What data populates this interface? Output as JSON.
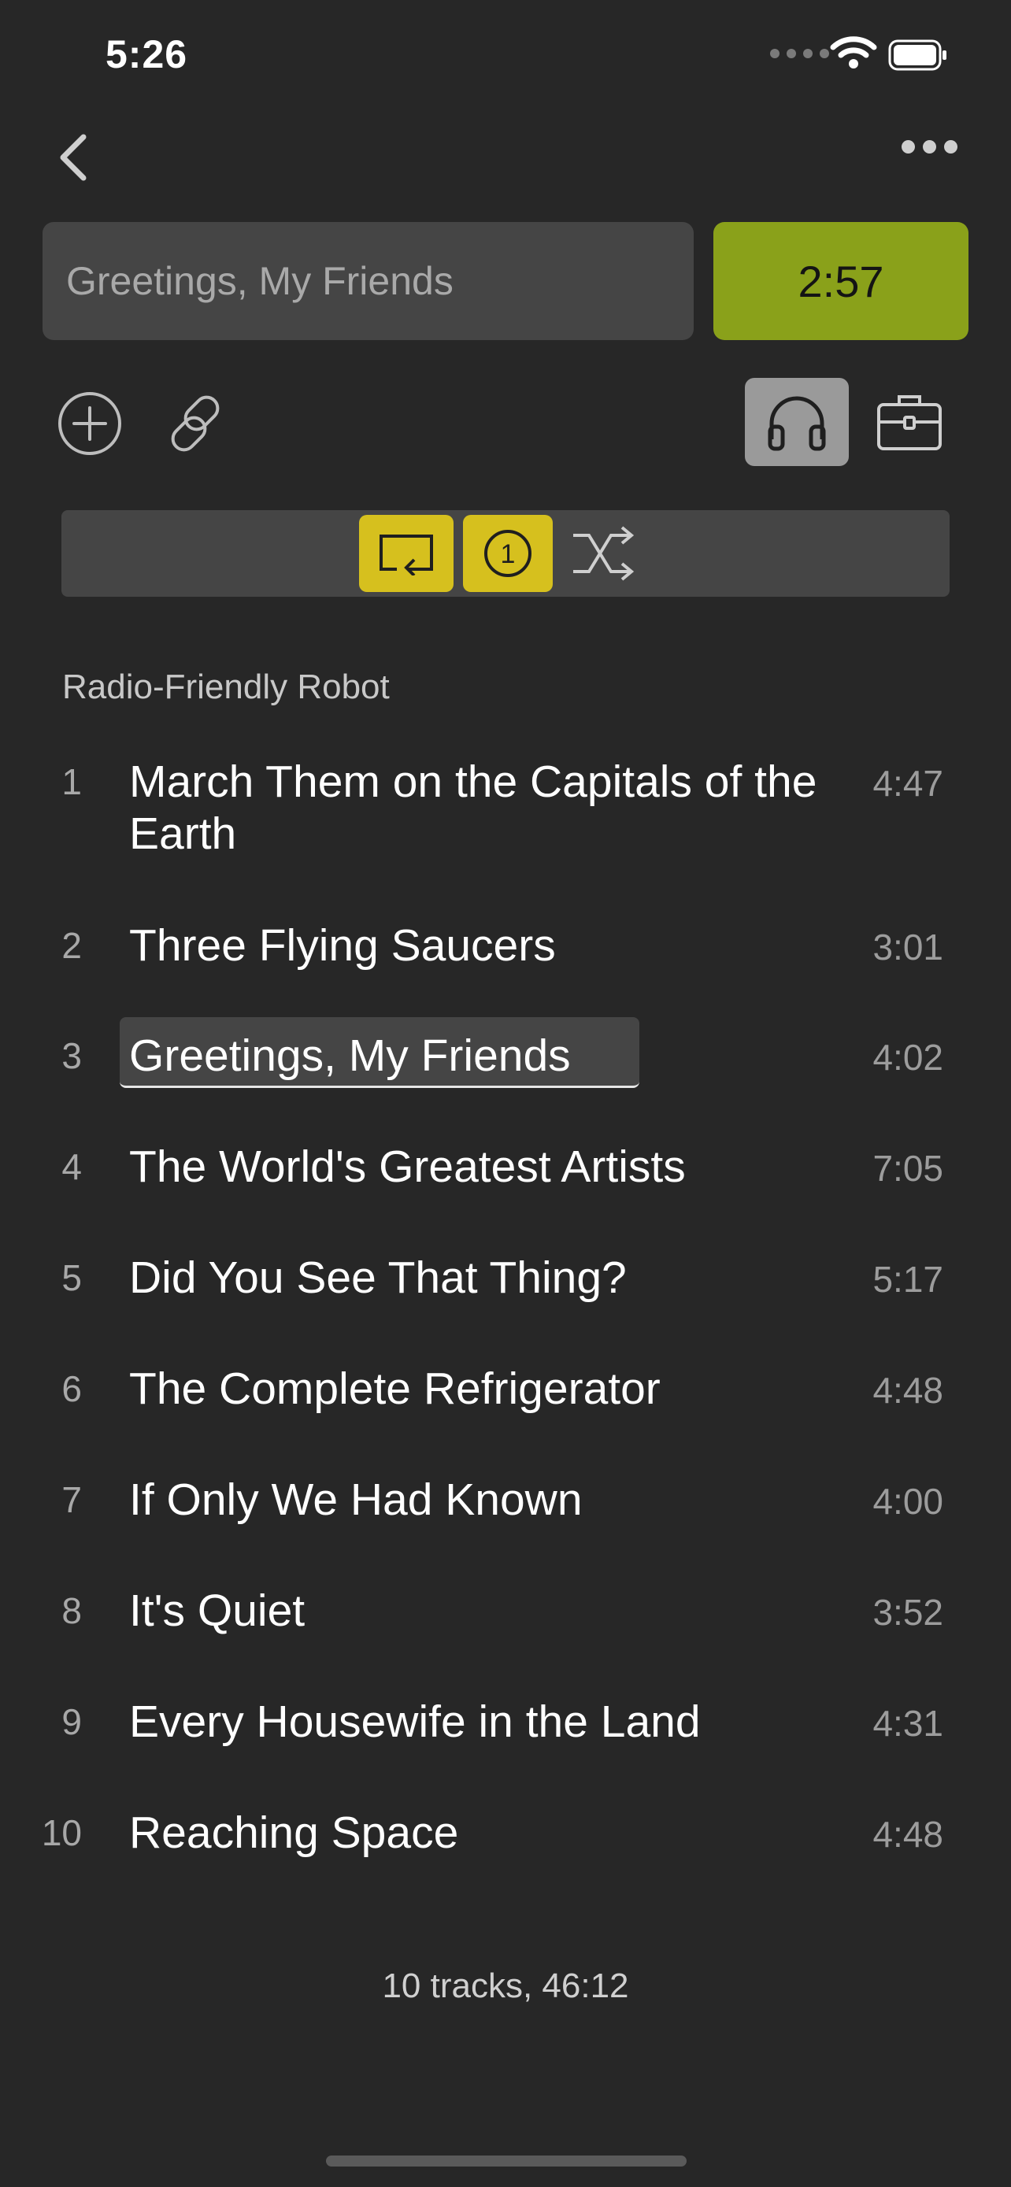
{
  "status_bar": {
    "time": "5:26"
  },
  "header": {
    "back_icon": "chevron-left-icon",
    "more_icon": "ellipsis-icon"
  },
  "now_playing": {
    "title_value": "Greetings, My Friends",
    "timer": "2:57",
    "timer_color": "#8aa11a"
  },
  "toolbar": {
    "icons": [
      "plus-circle-icon",
      "link-icon",
      "headphones-icon",
      "toolbox-icon"
    ],
    "selected": "headphones-icon"
  },
  "playback_modes": {
    "accent_color": "#d6c01e",
    "items": [
      {
        "icon": "repeat-icon",
        "active": true
      },
      {
        "icon": "repeat-one-icon",
        "label": "1",
        "active": true
      },
      {
        "icon": "shuffle-icon",
        "active": false
      }
    ]
  },
  "album": {
    "title": "Radio-Friendly Robot"
  },
  "tracks": [
    {
      "num": "1",
      "title": "March Them on the Capitals of the Earth",
      "duration": "4:47"
    },
    {
      "num": "2",
      "title": "Three Flying Saucers",
      "duration": "3:01"
    },
    {
      "num": "3",
      "title": "Greetings, My Friends",
      "duration": "4:02",
      "current": true
    },
    {
      "num": "4",
      "title": "The World's Greatest Artists",
      "duration": "7:05"
    },
    {
      "num": "5",
      "title": "Did You See That Thing?",
      "duration": "5:17"
    },
    {
      "num": "6",
      "title": "The Complete Refrigerator",
      "duration": "4:48"
    },
    {
      "num": "7",
      "title": "If Only We Had Known",
      "duration": "4:00"
    },
    {
      "num": "8",
      "title": "It's Quiet",
      "duration": "3:52"
    },
    {
      "num": "9",
      "title": "Every Housewife in the Land",
      "duration": "4:31"
    },
    {
      "num": "10",
      "title": "Reaching Space",
      "duration": "4:48"
    }
  ],
  "summary": "10 tracks, 46:12"
}
